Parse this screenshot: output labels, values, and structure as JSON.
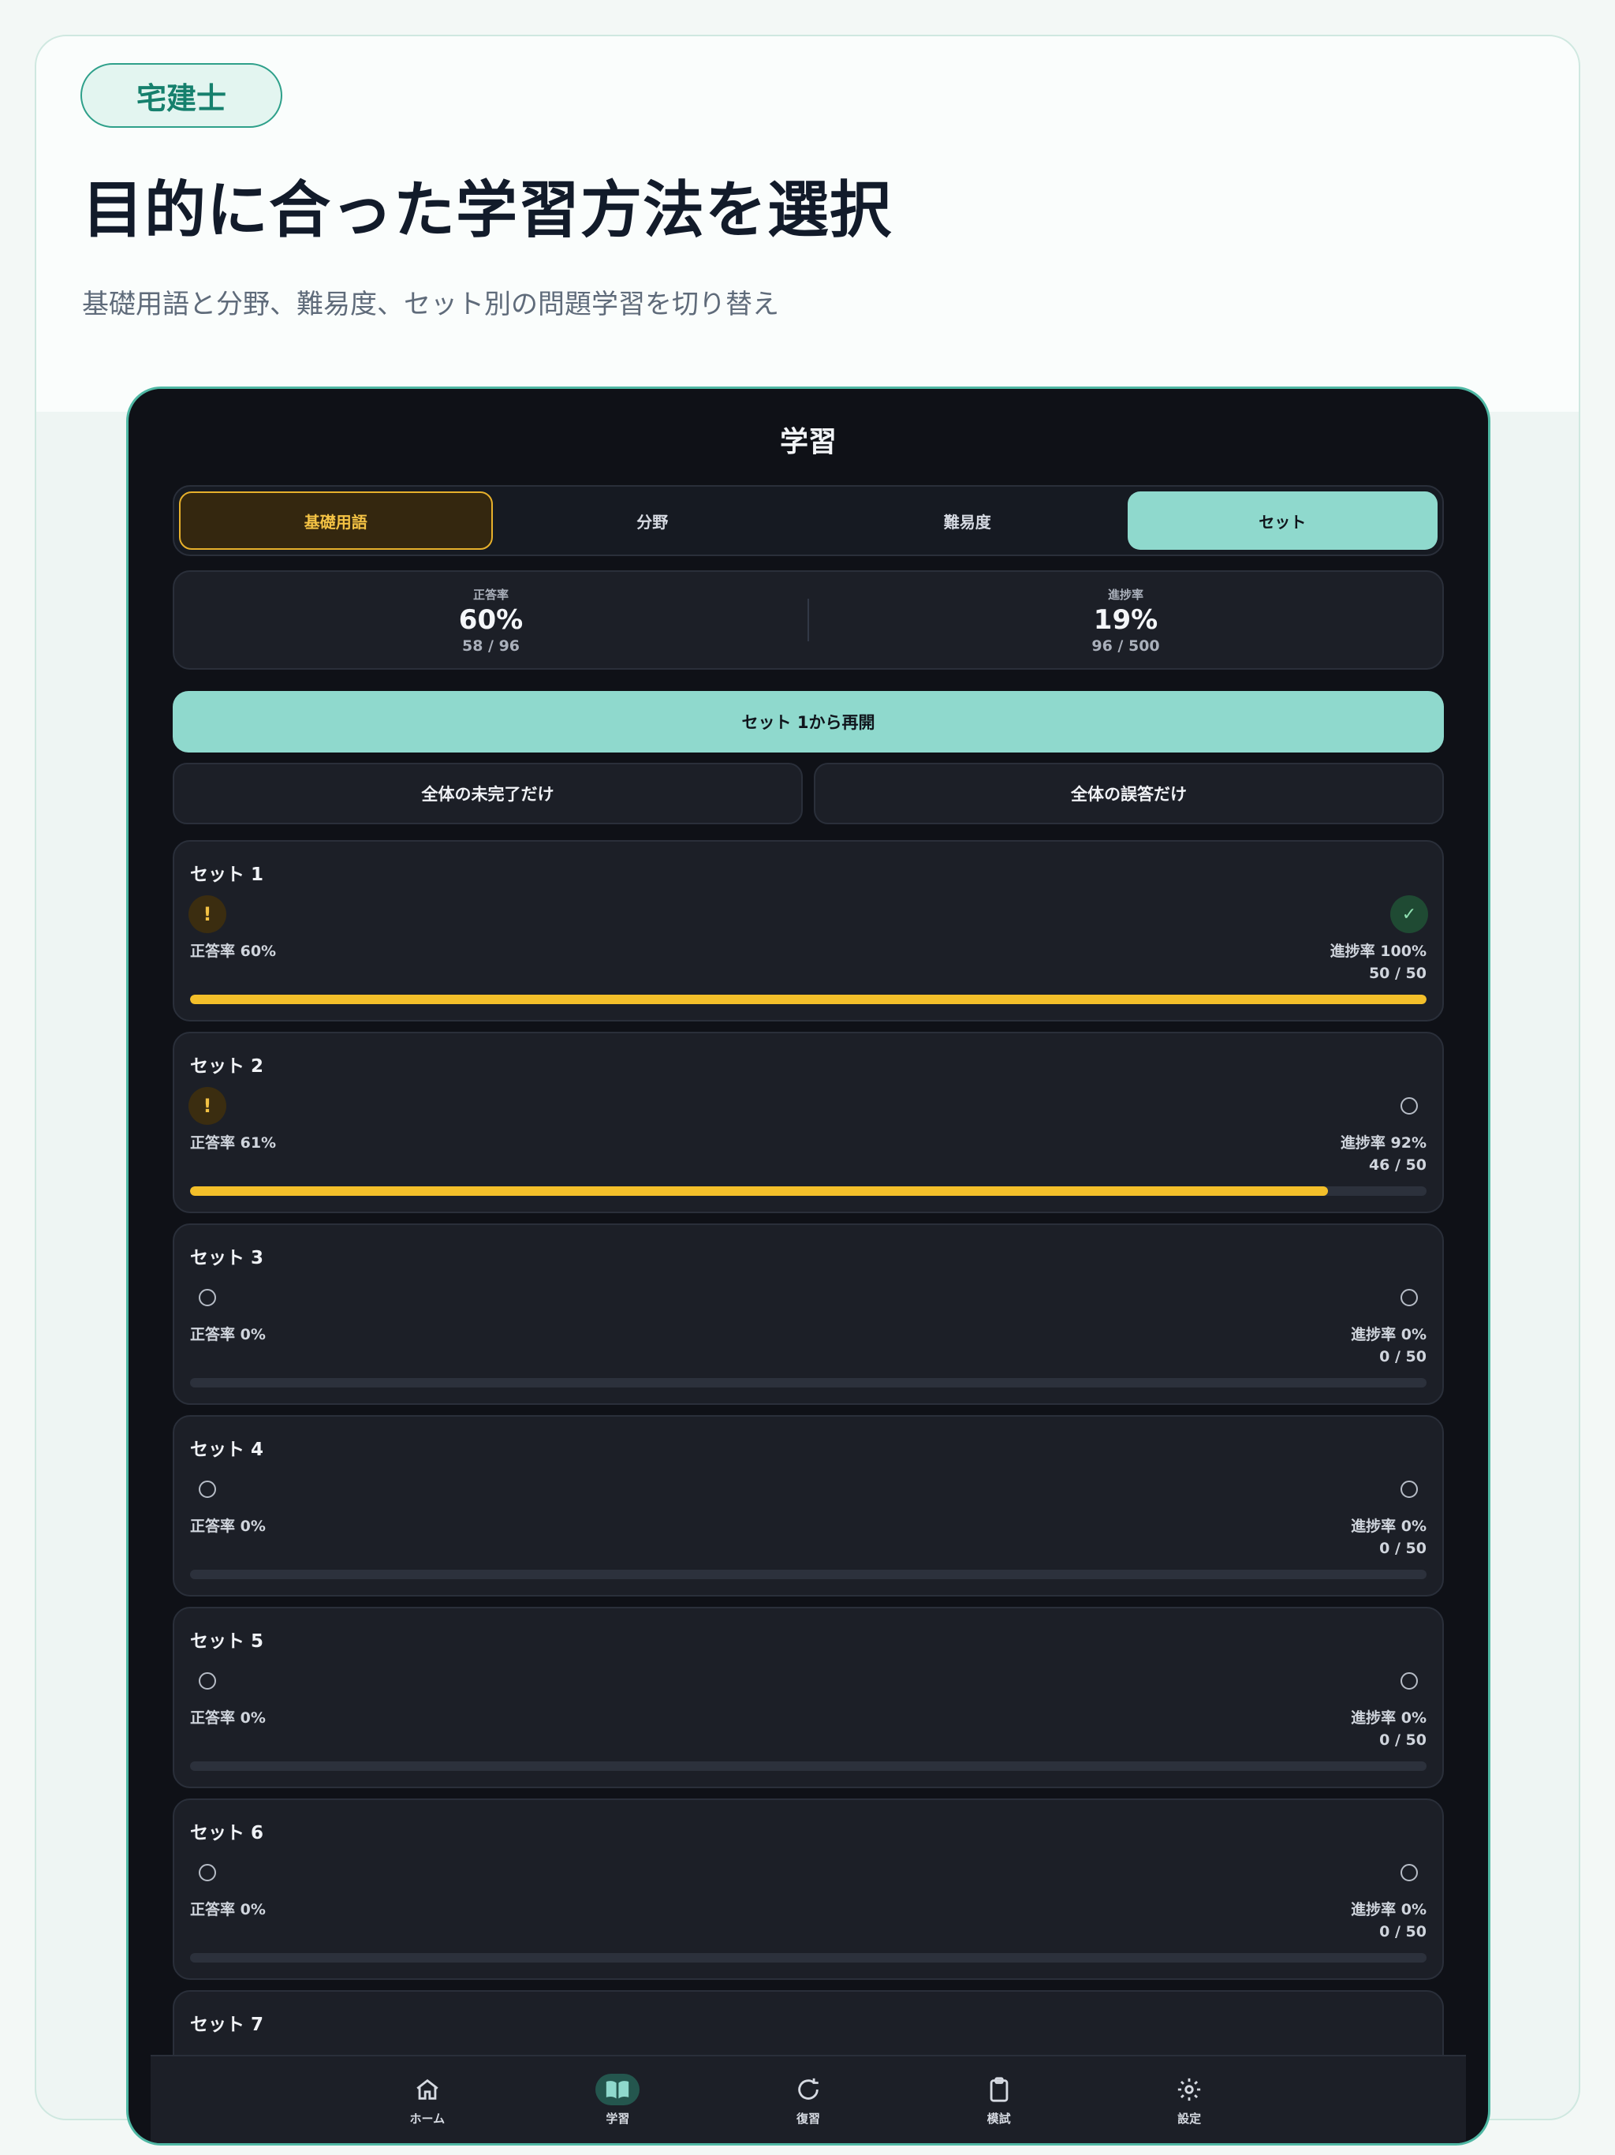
{
  "header": {
    "badge": "宅建士",
    "title": "目的に合った学習方法を選択",
    "subtitle": "基礎用語と分野、難易度、セット別の問題学習を切り替え"
  },
  "app": {
    "title": "学習",
    "segments": [
      {
        "label": "基礎用語",
        "state": "amber"
      },
      {
        "label": "分野",
        "state": "none"
      },
      {
        "label": "難易度",
        "state": "none"
      },
      {
        "label": "セット",
        "state": "selected"
      }
    ],
    "stats": {
      "accuracy": {
        "label": "正答率",
        "value": "60%",
        "sub": "58 / 96"
      },
      "progress": {
        "label": "進捗率",
        "value": "19%",
        "sub": "96 / 500"
      }
    },
    "resume_label": "セット 1から再開",
    "filters": {
      "incomplete": "全体の未完了だけ",
      "wrong": "全体の誤答だけ"
    },
    "sets": [
      {
        "name": "セット 1",
        "left_icon": "warning-icon",
        "right_icon": "check-icon",
        "accuracy": "正答率 60%",
        "progress": "進捗率 100%",
        "count": "50 / 50",
        "fill": 1.0
      },
      {
        "name": "セット 2",
        "left_icon": "warning-icon",
        "right_icon": "circle-icon",
        "accuracy": "正答率 61%",
        "progress": "進捗率 92%",
        "count": "46 / 50",
        "fill": 0.92
      },
      {
        "name": "セット 3",
        "left_icon": "circle-icon",
        "right_icon": "circle-icon",
        "accuracy": "正答率 0%",
        "progress": "進捗率 0%",
        "count": "0 / 50",
        "fill": 0
      },
      {
        "name": "セット 4",
        "left_icon": "circle-icon",
        "right_icon": "circle-icon",
        "accuracy": "正答率 0%",
        "progress": "進捗率 0%",
        "count": "0 / 50",
        "fill": 0
      },
      {
        "name": "セット 5",
        "left_icon": "circle-icon",
        "right_icon": "circle-icon",
        "accuracy": "正答率 0%",
        "progress": "進捗率 0%",
        "count": "0 / 50",
        "fill": 0
      },
      {
        "name": "セット 6",
        "left_icon": "circle-icon",
        "right_icon": "circle-icon",
        "accuracy": "正答率 0%",
        "progress": "進捗率 0%",
        "count": "0 / 50",
        "fill": 0
      },
      {
        "name": "セット 7",
        "left_icon": "circle-icon",
        "right_icon": "circle-icon",
        "accuracy": "",
        "progress": "",
        "count": "",
        "fill": 0
      }
    ],
    "tabs": [
      {
        "label": "ホーム",
        "icon": "home-icon",
        "active": false
      },
      {
        "label": "学習",
        "icon": "book-icon",
        "active": true
      },
      {
        "label": "復習",
        "icon": "refresh-icon",
        "active": false
      },
      {
        "label": "模試",
        "icon": "clipboard-icon",
        "active": false
      },
      {
        "label": "設定",
        "icon": "gear-icon",
        "active": false
      }
    ]
  },
  "colors": {
    "accent_mint": "#8fd9cd",
    "accent_amber": "#f3bf2a",
    "device_border": "#4fb8a4"
  }
}
